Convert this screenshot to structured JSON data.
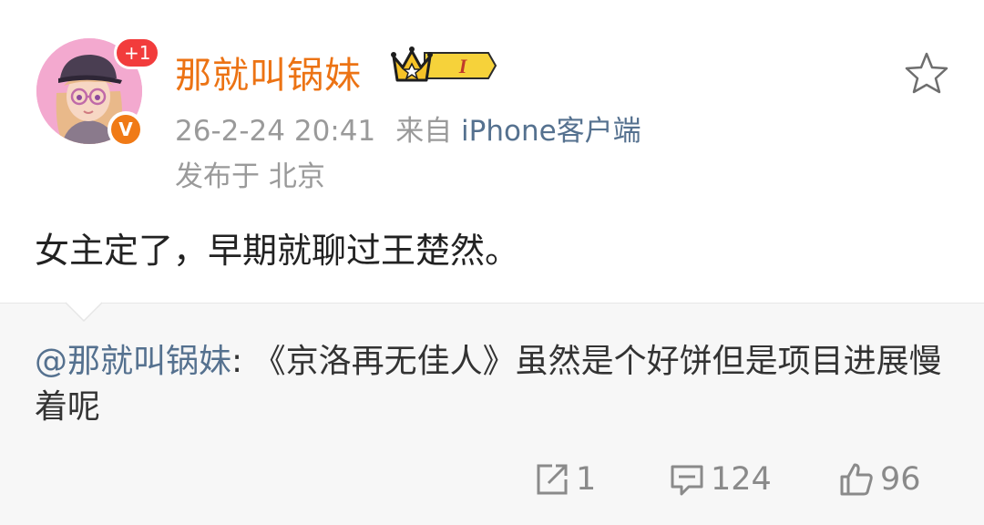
{
  "author": {
    "name": "那就叫锅妹",
    "notification_badge": "+1",
    "verified_badge": "V",
    "vip_badge_level": "I"
  },
  "meta": {
    "timestamp": "26-2-24 20:41",
    "source_prefix": "来自",
    "source": "iPhone客户端",
    "location": "发布于 北京"
  },
  "post": {
    "text": "女主定了，早期就聊过王楚然。"
  },
  "repost": {
    "mention": "@那就叫锅妹",
    "body": ": 《京洛再无佳人》虽然是个好饼但是项目进展慢着呢"
  },
  "actions": {
    "repost_count": "1",
    "comment_count": "124",
    "like_count": "96"
  },
  "icons": {
    "favorite": "star-outline-icon",
    "repost": "share-icon",
    "comment": "comment-icon",
    "like": "thumbs-up-icon",
    "vip": "crown-icon"
  },
  "colors": {
    "username": "#ec7314",
    "link": "#55718f",
    "meta": "#9a9a9a",
    "badge_red": "#f23c3c",
    "verified_orange": "#f07a16",
    "repost_bg": "#f7f7f7"
  }
}
